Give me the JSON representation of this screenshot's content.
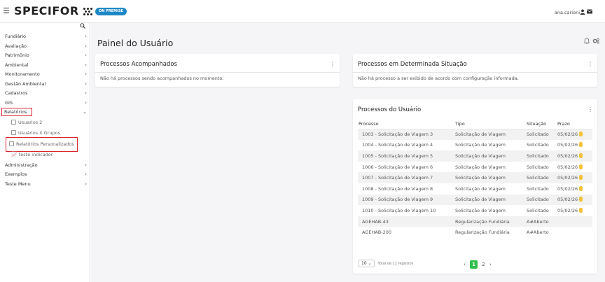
{
  "header": {
    "menu_icon": "hamburger-icon",
    "logo_text": "SPECIFOR",
    "badge": "ON PREMISE",
    "user_name": "ana.carioni",
    "user_icon": "user-icon",
    "mail_icon": "mail-icon"
  },
  "sidebar": {
    "search_icon": "search-icon",
    "items": [
      {
        "label": "Fundiário",
        "expanded": false
      },
      {
        "label": "Avaliação",
        "expanded": false
      },
      {
        "label": "Patrimônio",
        "expanded": false
      },
      {
        "label": "Ambiental",
        "expanded": false
      },
      {
        "label": "Monitoramento",
        "expanded": false
      },
      {
        "label": "Gestão Ambiental",
        "expanded": false
      },
      {
        "label": "Cadastros",
        "expanded": false
      },
      {
        "label": "GIS",
        "expanded": false
      },
      {
        "label": "Relatórios",
        "expanded": true
      }
    ],
    "relatorios_sub": [
      {
        "label": "Usuarios 2"
      },
      {
        "label": "Usuários X Grupos"
      },
      {
        "label": "Relatórios Personalizados"
      },
      {
        "label": "teste indicador"
      }
    ],
    "items_after": [
      {
        "label": "Administração"
      },
      {
        "label": "Exemplos"
      },
      {
        "label": "Teste Menu"
      }
    ]
  },
  "main": {
    "title": "Painel do Usuário",
    "bell_icon": "bell-icon",
    "settings_icon": "gears-icon",
    "cards": {
      "acompanhados": {
        "title": "Processos Acompanhados",
        "empty": "Não há processos sendo acompanhados no momento."
      },
      "situacao": {
        "title": "Processos em Determinada Situação",
        "empty": "Não há processo a ser exibido de acordo com configuração informada."
      },
      "usuario": {
        "title": "Processos do Usuário",
        "columns": [
          "Processo",
          "Tipo",
          "Situação",
          "Prazo"
        ],
        "rows": [
          {
            "processo": "1003 - Solicitação de Viagem 3",
            "tipo": "Solicitação de Viagem",
            "situacao": "Solicitado",
            "prazo": "05/02/26"
          },
          {
            "processo": "1004 - Solicitação de Viagem 4",
            "tipo": "Solicitação de Viagem",
            "situacao": "Solicitado",
            "prazo": "05/02/26"
          },
          {
            "processo": "1005 - Solicitação de Viagem 5",
            "tipo": "Solicitação de Viagem",
            "situacao": "Solicitado",
            "prazo": "05/02/26"
          },
          {
            "processo": "1006 - Solicitação de Viagem 6",
            "tipo": "Solicitação de Viagem",
            "situacao": "Solicitado",
            "prazo": "05/02/26"
          },
          {
            "processo": "1007 - Solicitação de Viagem 7",
            "tipo": "Solicitação de Viagem",
            "situacao": "Solicitado",
            "prazo": "05/02/26"
          },
          {
            "processo": "1008 - Solicitação de Viagem 8",
            "tipo": "Solicitação de Viagem",
            "situacao": "Solicitado",
            "prazo": "05/02/26"
          },
          {
            "processo": "1009 - Solicitação de Viagem 9",
            "tipo": "Solicitação de Viagem",
            "situacao": "Solicitado",
            "prazo": "05/02/26"
          },
          {
            "processo": "1010 - Solicitação de Viagem 10",
            "tipo": "Solicitação de Viagem",
            "situacao": "Solicitado",
            "prazo": "05/02/26"
          },
          {
            "processo": "AGEHAB-43",
            "tipo": "Regularização Fundiária",
            "situacao": "A#Aberto",
            "prazo": ""
          },
          {
            "processo": "AGEHAB-200",
            "tipo": "Regularização Fundiária",
            "situacao": "A#Aberto",
            "prazo": ""
          }
        ],
        "page_size": "10",
        "total_text": "Total de 11 registros",
        "pages": [
          "1",
          "2"
        ],
        "current_page": "1"
      }
    }
  },
  "colors": {
    "badge": "#1e88c7",
    "highlight_outline": "#d9262c",
    "current_page": "#2fbf4a",
    "prazo_marker": "#f2c33b"
  }
}
